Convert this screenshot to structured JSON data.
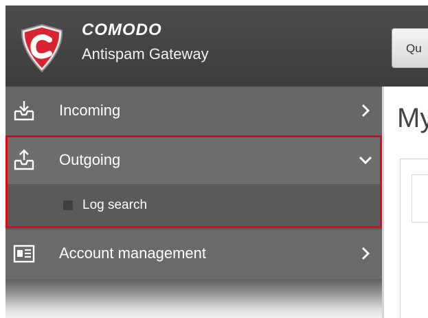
{
  "app": {
    "brand_name": "COMODO",
    "product_name": "Antispam Gateway",
    "header_button_label": "Qu"
  },
  "sidebar": {
    "items": [
      {
        "label": "Incoming",
        "icon": "inbox-download-icon",
        "chevron": "chevron-right-icon",
        "expanded": false
      },
      {
        "label": "Outgoing",
        "icon": "outbox-upload-icon",
        "chevron": "chevron-down-icon",
        "expanded": true,
        "children": [
          {
            "label": "Log search"
          }
        ]
      },
      {
        "label": "Account management",
        "icon": "id-card-icon",
        "chevron": "chevron-right-icon",
        "expanded": false
      }
    ]
  },
  "main": {
    "title": "My"
  },
  "colors": {
    "header_bg": "#444444",
    "sidebar_bg": "#6c6c6c",
    "submenu_bg": "#5a5a5a",
    "highlight": "#e30613",
    "logo_red": "#d9232e"
  }
}
